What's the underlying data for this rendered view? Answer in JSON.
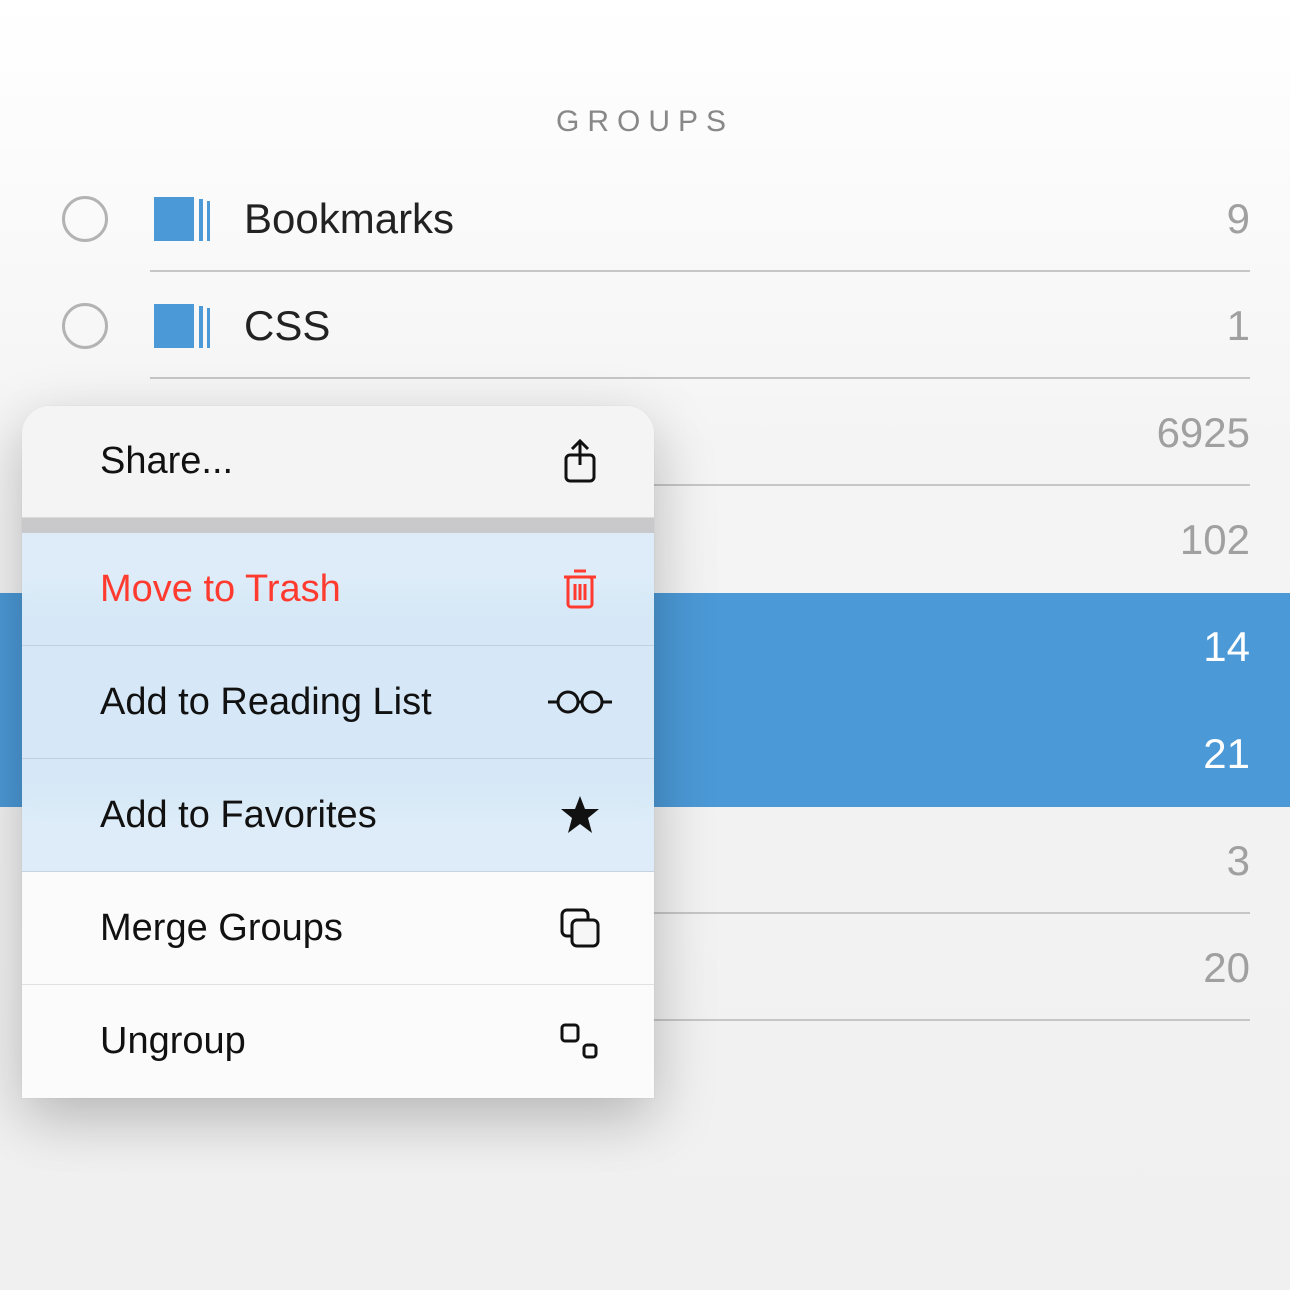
{
  "header": {
    "title": "GROUPS"
  },
  "groups": [
    {
      "label": "Bookmarks",
      "count": "9",
      "selected": false,
      "show_radio": true
    },
    {
      "label": "CSS",
      "count": "1",
      "selected": false,
      "show_radio": true
    },
    {
      "label": "",
      "count": "6925",
      "selected": false,
      "show_radio": false
    },
    {
      "label": "",
      "count": "102",
      "selected": false,
      "show_radio": false
    },
    {
      "label": "",
      "count": "14",
      "selected": true,
      "show_radio": false
    },
    {
      "label": "",
      "count": "21",
      "selected": true,
      "show_radio": false
    },
    {
      "label": "",
      "count": "3",
      "selected": false,
      "show_radio": false
    },
    {
      "label": "",
      "count": "20",
      "selected": false,
      "show_radio": false
    },
    {
      "label": "",
      "count": "",
      "selected": false,
      "show_radio": false
    }
  ],
  "menu": {
    "share": "Share...",
    "trash": "Move to Trash",
    "reading_list": "Add to Reading List",
    "favorites": "Add to Favorites",
    "merge": "Merge Groups",
    "ungroup": "Ungroup"
  },
  "colors": {
    "folder": "#4b99d7",
    "destructive": "#ff3b30",
    "selection": "#4b99d7"
  }
}
